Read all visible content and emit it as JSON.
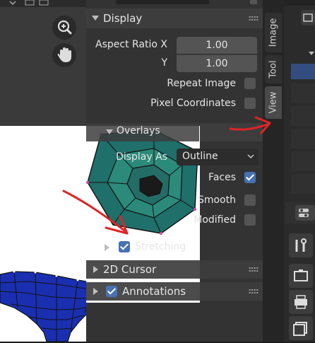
{
  "display_panel": {
    "title": "Display",
    "aspect_ratio_x_label": "Aspect Ratio X",
    "aspect_ratio_x": "1.00",
    "aspect_ratio_y_label": "Y",
    "aspect_ratio_y": "1.00",
    "repeat_image_label": "Repeat Image",
    "pixel_coordinates_label": "Pixel Coordinates"
  },
  "overlays": {
    "title": "Overlays",
    "display_as_label": "Display As",
    "display_as_value": "Outline",
    "faces_label": "Faces",
    "smooth_label": "Smooth",
    "modified_label": "Modified",
    "stretching_label": "Stretching"
  },
  "sections": {
    "cursor_2d": "2D Cursor",
    "annotations": "Annotations"
  },
  "tabs": [
    "Image",
    "Tool",
    "View"
  ],
  "colors": {
    "accent": "#4772b3",
    "annotation_arrow": "#e02424",
    "mesh_blue": "#1a2fb0",
    "mesh_teal": "#1f6f6a"
  }
}
